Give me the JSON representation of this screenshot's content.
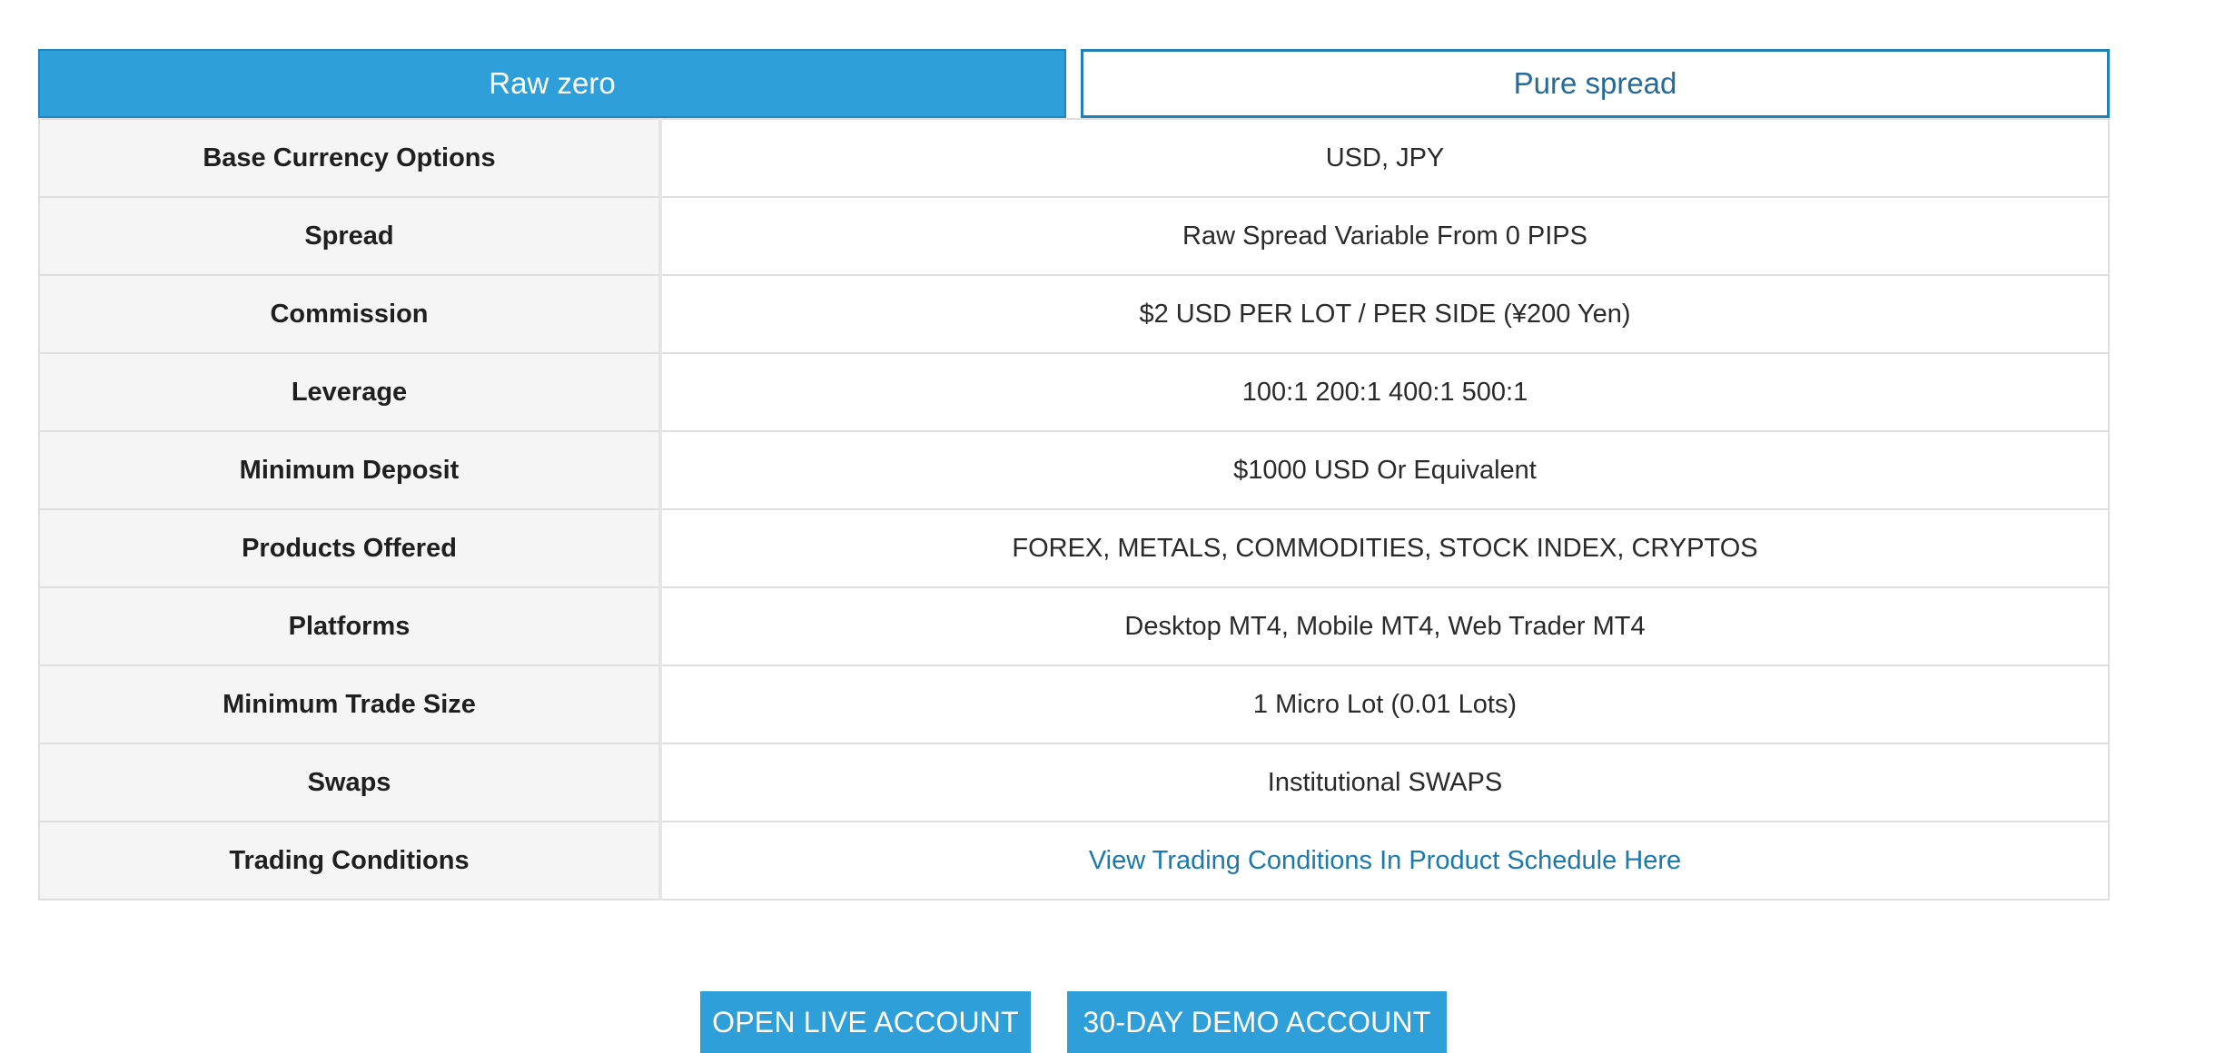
{
  "tabs": [
    {
      "label": "Raw zero"
    },
    {
      "label": "Pure spread"
    }
  ],
  "rows": [
    {
      "label": "Base Currency Options",
      "value": "USD, JPY"
    },
    {
      "label": "Spread",
      "value": "Raw Spread Variable From 0 PIPS"
    },
    {
      "label": "Commission",
      "value": "$2 USD PER LOT / PER SIDE (¥200 Yen)"
    },
    {
      "label": "Leverage",
      "value": "100:1 200:1 400:1 500:1"
    },
    {
      "label": "Minimum Deposit",
      "value": "$1000 USD Or Equivalent"
    },
    {
      "label": "Products Offered",
      "value": "FOREX, METALS, COMMODITIES, STOCK INDEX, CRYPTOS"
    },
    {
      "label": "Platforms",
      "value": "Desktop MT4, Mobile MT4, Web Trader MT4"
    },
    {
      "label": "Minimum Trade Size",
      "value": "1 Micro Lot (0.01 Lots)"
    },
    {
      "label": "Swaps",
      "value": "Institutional SWAPS"
    },
    {
      "label": "Trading Conditions",
      "value": "View Trading Conditions In Product Schedule Here"
    }
  ],
  "actions": {
    "live_label": "OPEN LIVE ACCOUNT",
    "demo_label": "30-DAY DEMO ACCOUNT"
  },
  "colors": {
    "accent": "#2e9fd9",
    "accent_border": "#1f86bf",
    "link": "#1b79ad",
    "label_bg": "#f5f5f5",
    "border": "#dedede"
  }
}
